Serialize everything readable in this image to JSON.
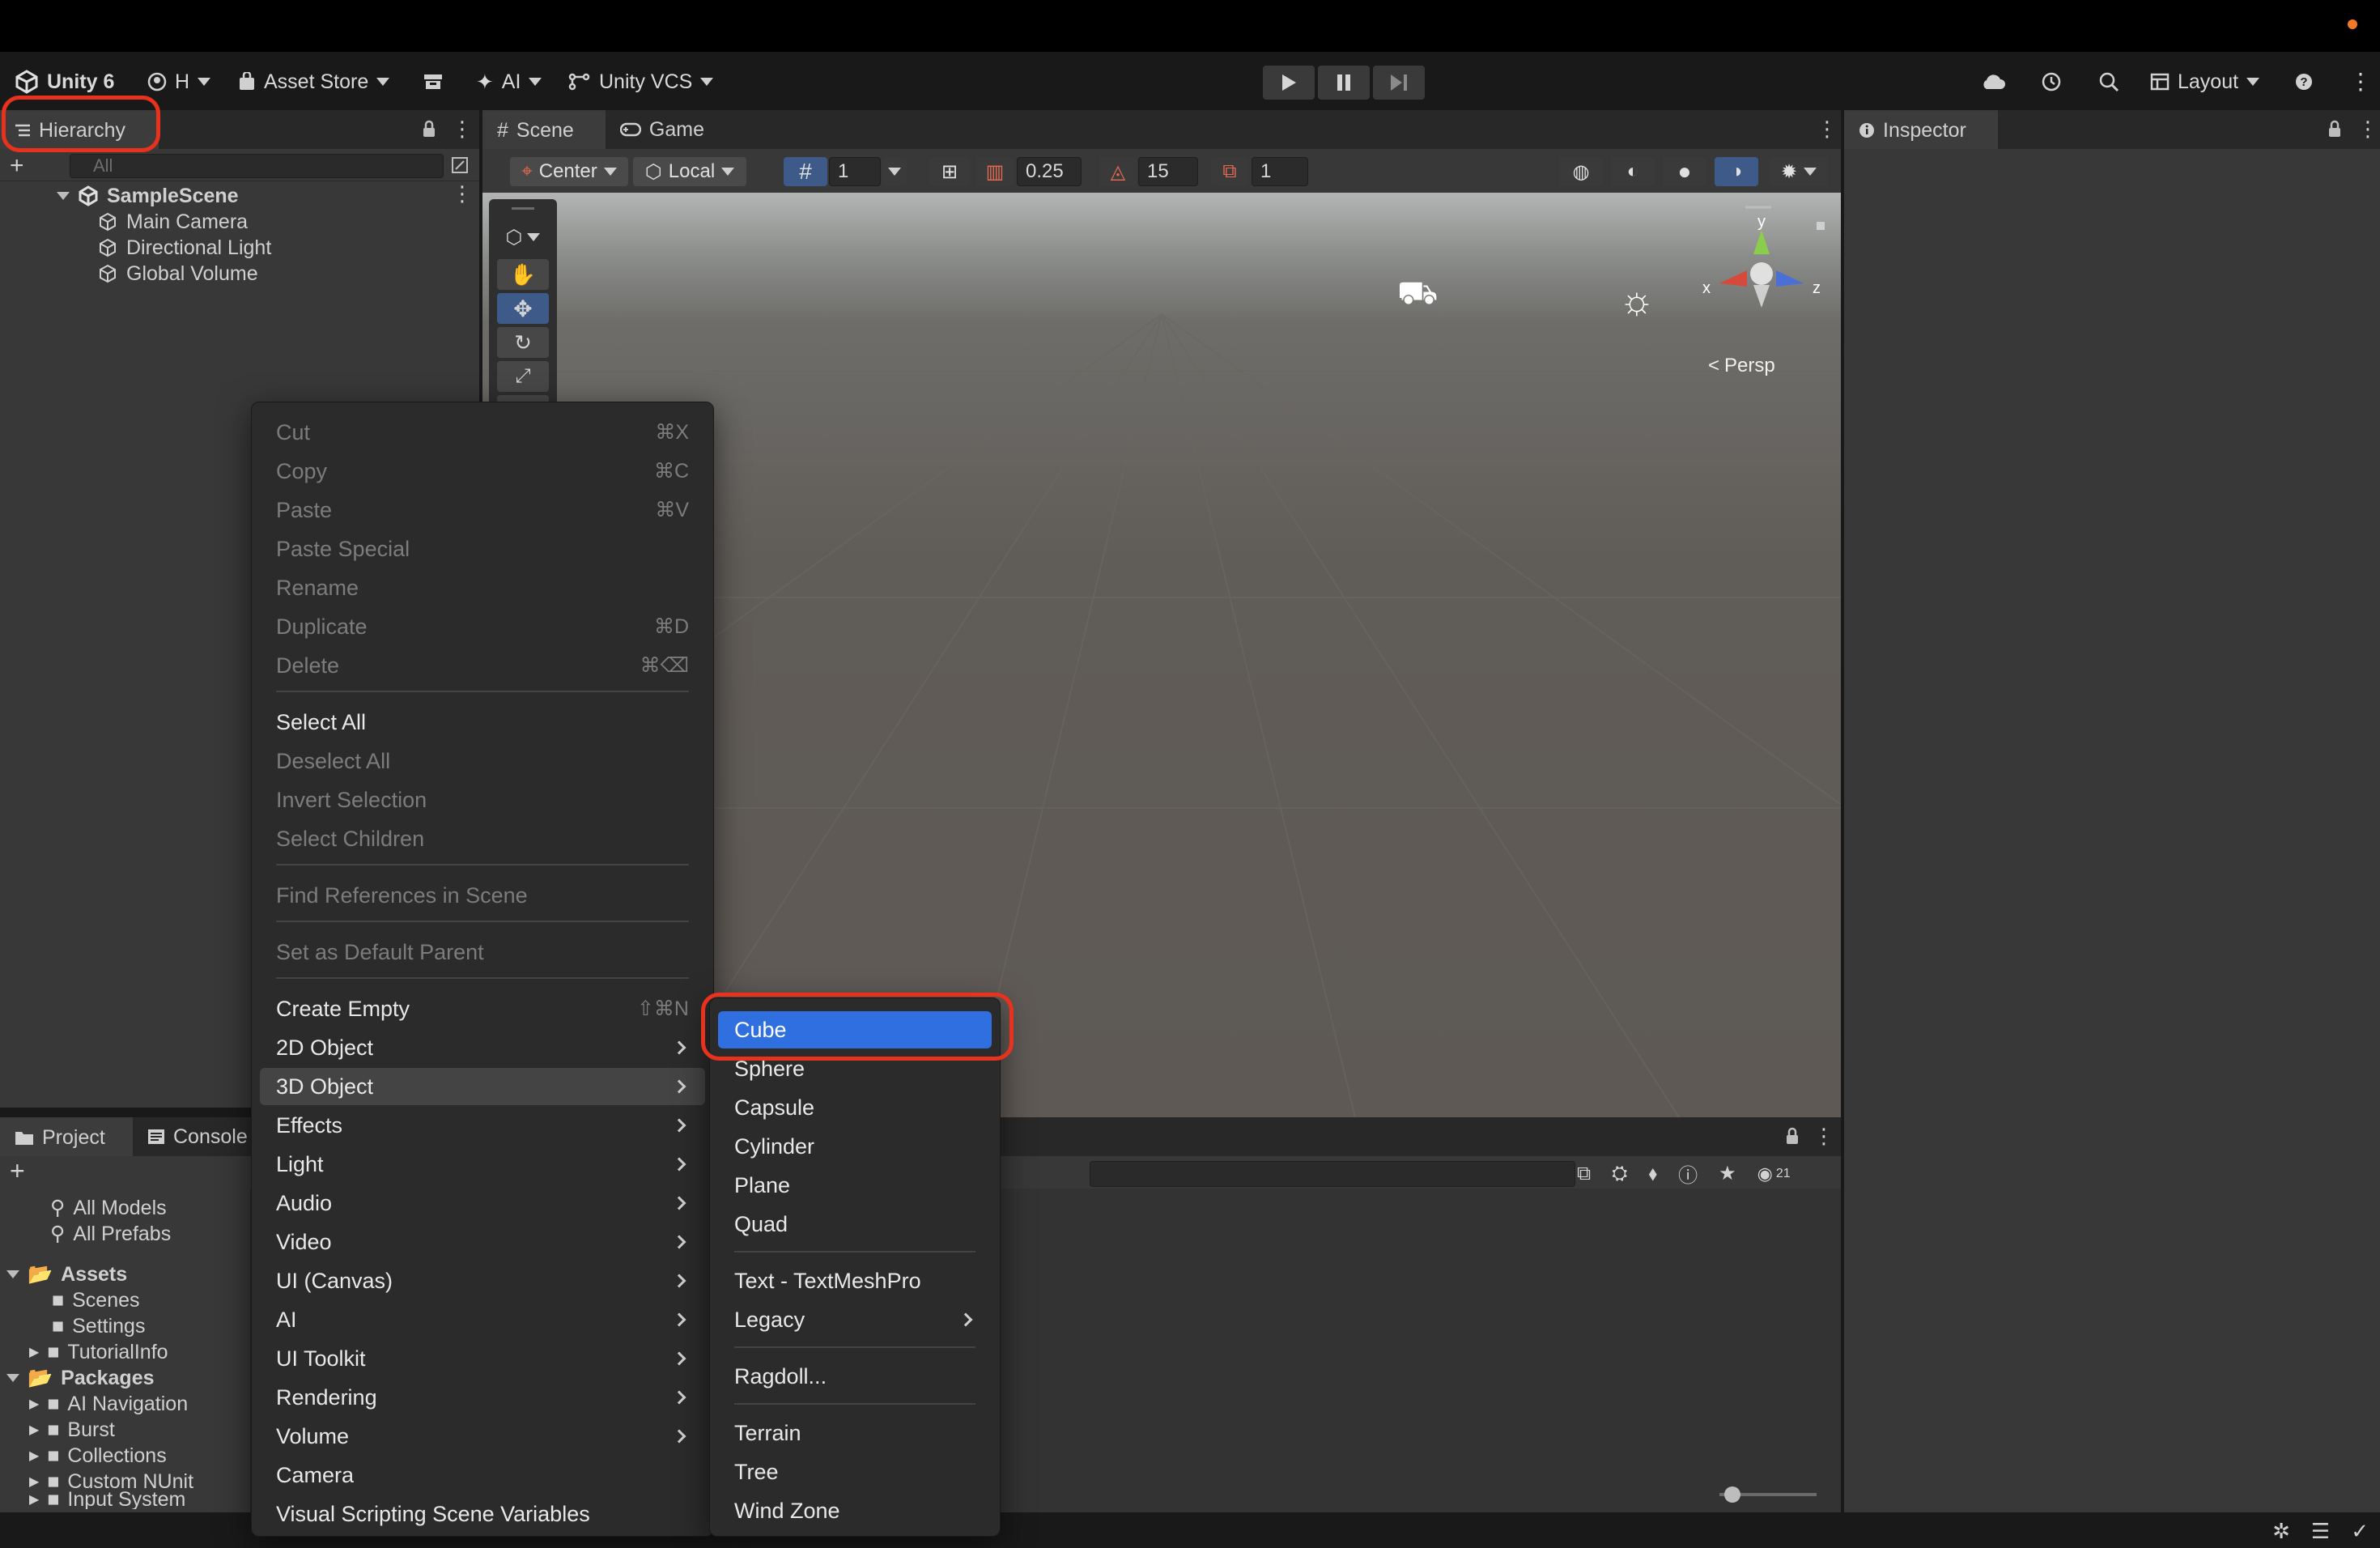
{
  "toolbar": {
    "app": "Unity 6",
    "account": "H",
    "asset_store": "Asset Store",
    "ai": "AI",
    "vcs": "Unity VCS",
    "layout": "Layout"
  },
  "hierarchy": {
    "tab": "Hierarchy",
    "search_placeholder": "All",
    "scene": "SampleScene",
    "children": [
      "Main Camera",
      "Directional Light",
      "Global Volume"
    ]
  },
  "scene_view": {
    "tabs": [
      "Scene",
      "Game"
    ],
    "pivot": "Center",
    "space": "Local",
    "grid_value": "1",
    "snap_value": "0.25",
    "rotate_snap": "15",
    "scale_snap": "1",
    "projection": "Persp",
    "axes": {
      "x": "x",
      "y": "y",
      "z": "z"
    }
  },
  "inspector": {
    "tab": "Inspector"
  },
  "project": {
    "tabs": [
      "Project",
      "Console"
    ],
    "favorites": [
      "All Models",
      "All Prefabs"
    ],
    "assets_label": "Assets",
    "assets": [
      "Scenes",
      "Settings",
      "TutorialInfo"
    ],
    "packages_label": "Packages",
    "packages": [
      "AI Navigation",
      "Burst",
      "Collections",
      "Custom NUnit",
      "Input System"
    ],
    "count": "21"
  },
  "context_menu": {
    "cut": "Cut",
    "cut_sc": "⌘X",
    "copy": "Copy",
    "copy_sc": "⌘C",
    "paste": "Paste",
    "paste_sc": "⌘V",
    "paste_special": "Paste Special",
    "rename": "Rename",
    "duplicate": "Duplicate",
    "duplicate_sc": "⌘D",
    "delete": "Delete",
    "delete_sc": "⌘⌫",
    "select_all": "Select All",
    "deselect_all": "Deselect All",
    "invert_selection": "Invert Selection",
    "select_children": "Select Children",
    "find_references": "Find References in Scene",
    "set_default_parent": "Set as Default Parent",
    "create_empty": "Create Empty",
    "create_empty_sc": "⇧⌘N",
    "obj_2d": "2D Object",
    "obj_3d": "3D Object",
    "effects": "Effects",
    "light": "Light",
    "audio": "Audio",
    "video": "Video",
    "ui_canvas": "UI (Canvas)",
    "ai": "AI",
    "ui_toolkit": "UI Toolkit",
    "rendering": "Rendering",
    "volume": "Volume",
    "camera": "Camera",
    "visual_scripting": "Visual Scripting Scene Variables"
  },
  "sub_menu": {
    "cube": "Cube",
    "sphere": "Sphere",
    "capsule": "Capsule",
    "cylinder": "Cylinder",
    "plane": "Plane",
    "quad": "Quad",
    "text_tmp": "Text - TextMeshPro",
    "legacy": "Legacy",
    "ragdoll": "Ragdoll...",
    "terrain": "Terrain",
    "tree": "Tree",
    "wind_zone": "Wind Zone"
  },
  "colors": {
    "accent": "#2f6fdf",
    "highlight_ring": "#e8321e",
    "orange_dot": "#f07a2a"
  }
}
